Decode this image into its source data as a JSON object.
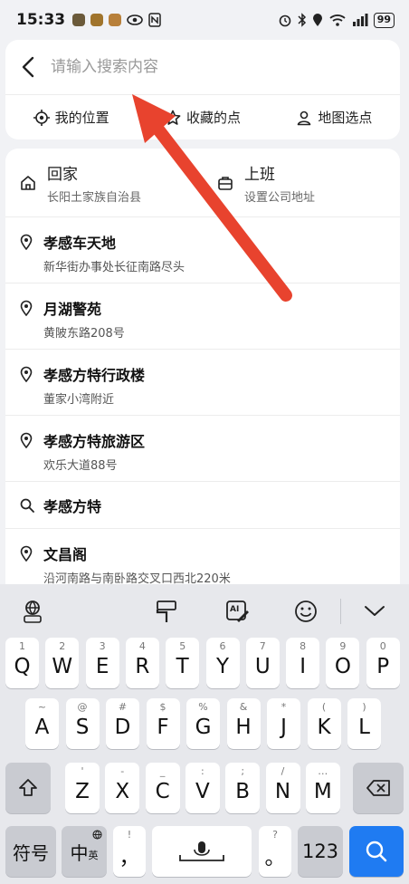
{
  "status": {
    "time": "15:33",
    "battery": "99"
  },
  "search": {
    "placeholder": "请输入搜索内容"
  },
  "quick": [
    {
      "label": "我的位置",
      "icon": "crosshair-icon"
    },
    {
      "label": "收藏的点",
      "icon": "star-icon"
    },
    {
      "label": "地图选点",
      "icon": "map-pin-person-icon"
    }
  ],
  "home": {
    "title": "回家",
    "sub": "长阳土家族自治县"
  },
  "work": {
    "title": "上班",
    "sub": "设置公司地址"
  },
  "items": [
    {
      "title": "孝感车天地",
      "sub": "新华街办事处长征南路尽头",
      "icon": "location-pin-icon"
    },
    {
      "title": "月湖警苑",
      "sub": "黄陂东路208号",
      "icon": "location-pin-icon"
    },
    {
      "title": "孝感方特行政楼",
      "sub": "董家小湾附近",
      "icon": "location-pin-icon"
    },
    {
      "title": "孝感方特旅游区",
      "sub": "欢乐大道88号",
      "icon": "location-pin-icon"
    },
    {
      "title": "孝感方特",
      "sub": "",
      "icon": "search-icon"
    },
    {
      "title": "文昌阁",
      "sub": "沿河南路与南卧路交叉口西北220米",
      "icon": "location-pin-icon"
    }
  ],
  "keyboard": {
    "row1": [
      {
        "k": "Q",
        "s": "1"
      },
      {
        "k": "W",
        "s": "2"
      },
      {
        "k": "E",
        "s": "3"
      },
      {
        "k": "R",
        "s": "4"
      },
      {
        "k": "T",
        "s": "5"
      },
      {
        "k": "Y",
        "s": "6"
      },
      {
        "k": "U",
        "s": "7"
      },
      {
        "k": "I",
        "s": "8"
      },
      {
        "k": "O",
        "s": "9"
      },
      {
        "k": "P",
        "s": "0"
      }
    ],
    "row2": [
      {
        "k": "A",
        "s": "~"
      },
      {
        "k": "S",
        "s": "@"
      },
      {
        "k": "D",
        "s": "#"
      },
      {
        "k": "F",
        "s": "$"
      },
      {
        "k": "G",
        "s": "%"
      },
      {
        "k": "H",
        "s": "&"
      },
      {
        "k": "J",
        "s": "*"
      },
      {
        "k": "K",
        "s": "("
      },
      {
        "k": "L",
        "s": ")"
      }
    ],
    "row3": [
      {
        "k": "Z",
        "s": "'"
      },
      {
        "k": "X",
        "s": "-"
      },
      {
        "k": "C",
        "s": "_"
      },
      {
        "k": "V",
        "s": ":"
      },
      {
        "k": "B",
        "s": ";"
      },
      {
        "k": "N",
        "s": "/"
      },
      {
        "k": "M",
        "s": "…"
      }
    ],
    "symbol_key": "符号",
    "lang_key": "中",
    "lang_sub": "英",
    "comma": "，",
    "comma_sub": "!",
    "period": "。",
    "period_sub": "?",
    "num_key": "123"
  }
}
